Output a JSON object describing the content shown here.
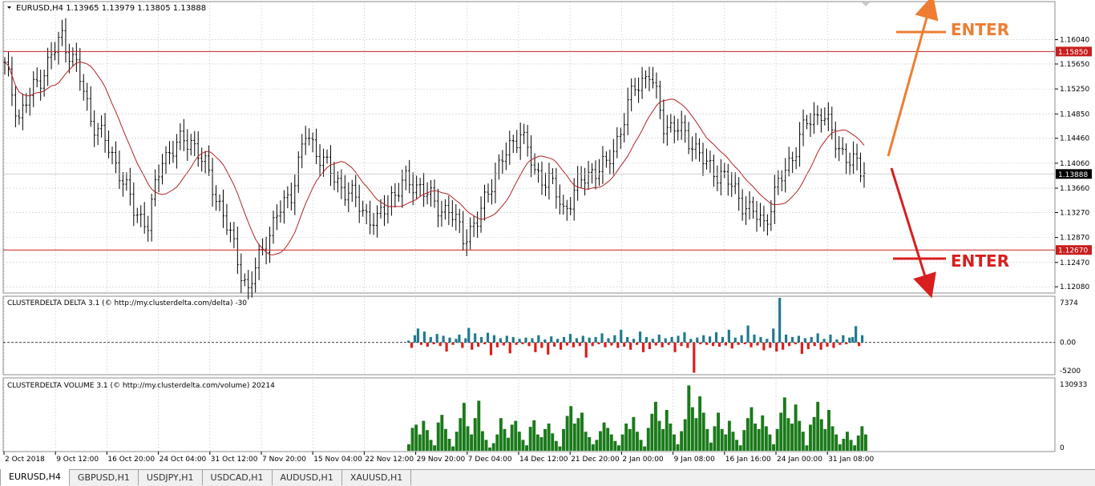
{
  "chart_data": {
    "type": "candlestick",
    "symbol_header": "EURUSD,H4  1.13965 1.13979 1.13805 1.13888",
    "y_ticks": [
      "1.16040",
      "1.15650",
      "1.15250",
      "1.14850",
      "1.14460",
      "1.14060",
      "1.13660",
      "1.13270",
      "1.12870",
      "1.12470",
      "1.12080"
    ],
    "ylim": [
      1.1198,
      1.1665
    ],
    "x_ticks": [
      "2 Oct 2018",
      "9 Oct 12:00",
      "16 Oct 20:00",
      "24 Oct 04:00",
      "31 Oct 12:00",
      "7 Nov 20:00",
      "15 Nov 04:00",
      "22 Nov 12:00",
      "29 Nov 20:00",
      "7 Dec 04:00",
      "14 Dec 12:00",
      "21 Dec 20:00",
      "2 Jan 00:00",
      "9 Jan 08:00",
      "16 Jan 16:00",
      "24 Jan 00:00",
      "31 Jan 08:00"
    ],
    "levels": [
      {
        "value": 1.1585,
        "label": "1.15850",
        "color": "#c81e1e"
      },
      {
        "value": 1.1267,
        "label": "1.12670",
        "color": "#c81e1e"
      }
    ],
    "current_price": {
      "value": 1.13888,
      "label": "1.13888"
    },
    "anchors_close": [
      1.156,
      1.148,
      1.1525,
      1.1565,
      1.161,
      1.156,
      1.148,
      1.144,
      1.1395,
      1.133,
      1.131,
      1.1415,
      1.1435,
      1.1445,
      1.14,
      1.134,
      1.127,
      1.12,
      1.127,
      1.132,
      1.136,
      1.145,
      1.142,
      1.138,
      1.136,
      1.133,
      1.131,
      1.1355,
      1.1375,
      1.137,
      1.134,
      1.133,
      1.129,
      1.131,
      1.138,
      1.142,
      1.146,
      1.139,
      1.138,
      1.133,
      1.137,
      1.1395,
      1.14,
      1.146,
      1.153,
      1.155,
      1.147,
      1.146,
      1.144,
      1.14,
      1.139,
      1.136,
      1.133,
      1.131,
      1.137,
      1.142,
      1.147,
      1.149,
      1.144,
      1.141,
      1.139
    ],
    "ma_color": "#b22222",
    "annotations": [
      {
        "text": "ENTER",
        "color": "#ee7d31",
        "arrow": "up"
      },
      {
        "text": "ENTER",
        "color": "#d81e1e",
        "arrow": "down"
      }
    ],
    "delta": {
      "title": "CLUSTERDELTA DELTA 3.1 (© http://my.clusterdelta.com/delta) -30",
      "ticks": [
        "7374",
        "0.00",
        "-5200"
      ],
      "ylim": [
        -5200,
        7374
      ],
      "pos_color": "#1f7a8c",
      "neg_color": "#e01b1b",
      "values": [
        300,
        -900,
        1200,
        2300,
        -400,
        1800,
        -700,
        900,
        -300,
        1400,
        -600,
        1100,
        -1500,
        800,
        -400,
        600,
        1300,
        -900,
        700,
        2400,
        -1200,
        1500,
        -700,
        900,
        -300,
        1600,
        -2100,
        1200,
        -800,
        700,
        -500,
        1100,
        -1800,
        900,
        -400,
        600,
        -300,
        800,
        -600,
        700,
        -1600,
        1200,
        -900,
        500,
        -2000,
        1000,
        -700,
        600,
        -1200,
        900,
        -500,
        1400,
        -800,
        700,
        -600,
        1100,
        -2500,
        800,
        -600,
        900,
        -300,
        1500,
        -800,
        700,
        -500,
        1200,
        -900,
        2100,
        -700,
        900,
        -1200,
        600,
        -400,
        1800,
        -1600,
        900,
        -1100,
        600,
        -500,
        1300,
        -800,
        700,
        -400,
        900,
        -1600,
        1100,
        -600,
        1700,
        -900,
        600,
        -5000,
        800,
        -300,
        1200,
        -400,
        1000,
        -600,
        1700,
        -700,
        900,
        -500,
        2100,
        -1000,
        800,
        -400,
        1200,
        -300,
        2800,
        -800,
        1300,
        -500,
        900,
        -1300,
        600,
        -900,
        2300,
        -1500,
        7374,
        -1200,
        1300,
        -600,
        900,
        -300,
        1100,
        -1900,
        700,
        -1100,
        900,
        -600,
        1500,
        -1200,
        600,
        -700,
        1300,
        -900,
        500,
        -400,
        1200,
        -300,
        800,
        900,
        2700,
        -600,
        1200
      ]
    },
    "volume": {
      "title": "CLUSTERDELTA VOLUME 3.1 (© http://my.clusterdelta.com/volume) 20214",
      "ticks": [
        "130933",
        "0"
      ],
      "ylim": [
        0,
        130933
      ],
      "color": "#1a7a1a",
      "values": [
        12000,
        42000,
        48000,
        30000,
        55000,
        38000,
        20000,
        10000,
        52000,
        66000,
        40000,
        22000,
        8000,
        35000,
        60000,
        88000,
        45000,
        30000,
        60000,
        92000,
        36000,
        20000,
        6000,
        14000,
        30000,
        60000,
        40000,
        24000,
        48000,
        55000,
        35000,
        20000,
        10000,
        44000,
        56000,
        30000,
        25000,
        40000,
        50000,
        32000,
        18000,
        8000,
        40000,
        64000,
        82000,
        50000,
        60000,
        70000,
        35000,
        25000,
        12000,
        20000,
        36000,
        52000,
        42000,
        30000,
        18000,
        10000,
        30000,
        50000,
        40000,
        62000,
        35000,
        20000,
        8000,
        42000,
        68000,
        90000,
        55000,
        40000,
        75000,
        50000,
        30000,
        12000,
        36000,
        58000,
        120000,
        80000,
        60000,
        100000,
        70000,
        40000,
        15000,
        45000,
        70000,
        40000,
        30000,
        55000,
        35000,
        20000,
        10000,
        38000,
        60000,
        80000,
        50000,
        40000,
        65000,
        45000,
        30000,
        12000,
        40000,
        70000,
        98000,
        60000,
        50000,
        85000,
        55000,
        35000,
        10000,
        48000,
        62000,
        90000,
        58000,
        40000,
        75000,
        45000,
        30000,
        12000,
        22000,
        35000,
        20000,
        10000,
        28000,
        45000,
        30000
      ]
    }
  },
  "tabs": [
    {
      "label": "EURUSD,H4",
      "active": true
    },
    {
      "label": "GBPUSD,H1",
      "active": false
    },
    {
      "label": "USDJPY,H1",
      "active": false
    },
    {
      "label": "USDCAD,H1",
      "active": false
    },
    {
      "label": "AUDUSD,H1",
      "active": false
    },
    {
      "label": "XAUUSD,H1",
      "active": false
    }
  ]
}
